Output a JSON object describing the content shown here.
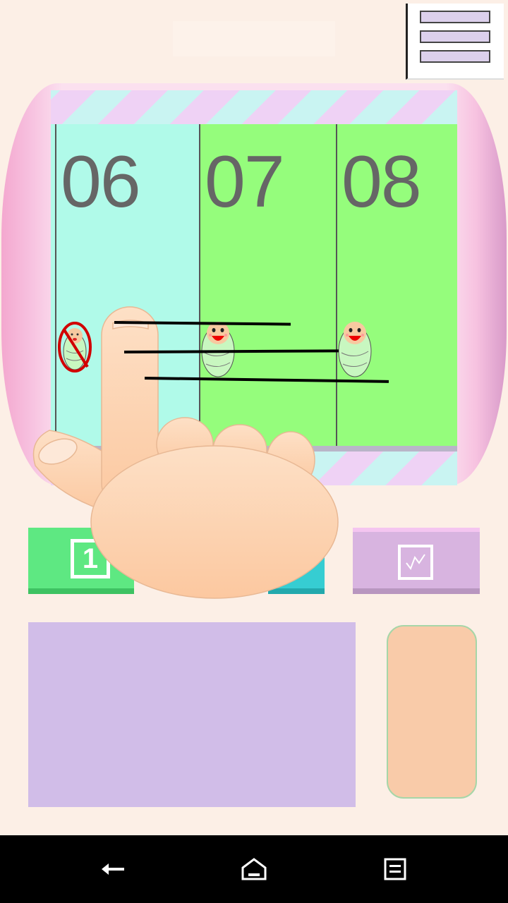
{
  "slots": [
    {
      "number": "06"
    },
    {
      "number": "07"
    },
    {
      "number": "08"
    }
  ],
  "buttons": {
    "green_number": "1"
  },
  "colors": {
    "slot_cyan": "#b0fae9",
    "slot_green": "#95fd7c",
    "panel": "#d1bde8",
    "hand": "#fdd3b0"
  },
  "icons": {
    "menu": "hamburger-menu-icon",
    "check": "chart-check-icon",
    "nav_back": "back-icon",
    "nav_home": "home-icon",
    "nav_recents": "recents-icon"
  }
}
